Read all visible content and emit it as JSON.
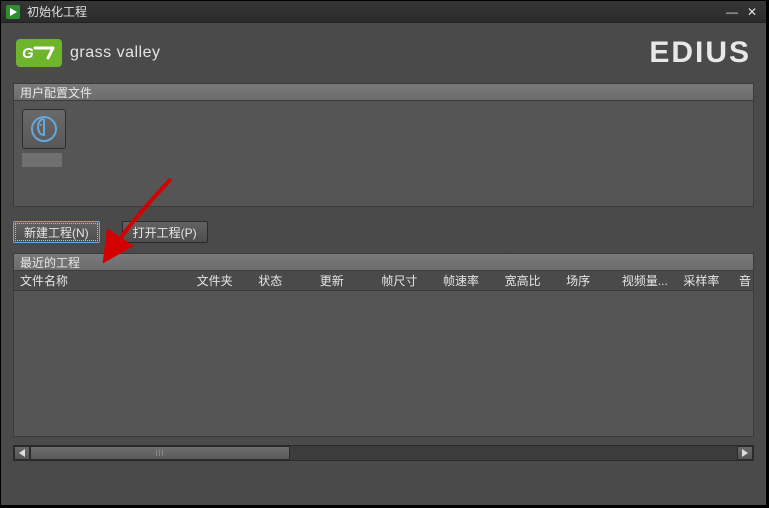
{
  "window": {
    "title": "初始化工程"
  },
  "brand": {
    "logo_text": "grass valley",
    "product": "EDIUS"
  },
  "profiles": {
    "header": "用户配置文件",
    "items": [
      {
        "name": ""
      }
    ]
  },
  "buttons": {
    "new_project": "新建工程(N)",
    "open_project": "打开工程(P)"
  },
  "recent": {
    "header": "最近的工程",
    "columns": {
      "filename": "文件名称",
      "folder": "文件夹",
      "status": "状态",
      "update": "更新",
      "framesize": "帧尺寸",
      "framerate": "帧速率",
      "aspect": "宽高比",
      "order": "场序",
      "quant": "视频量...",
      "sample": "采样率",
      "audio": "音"
    },
    "rows": []
  }
}
